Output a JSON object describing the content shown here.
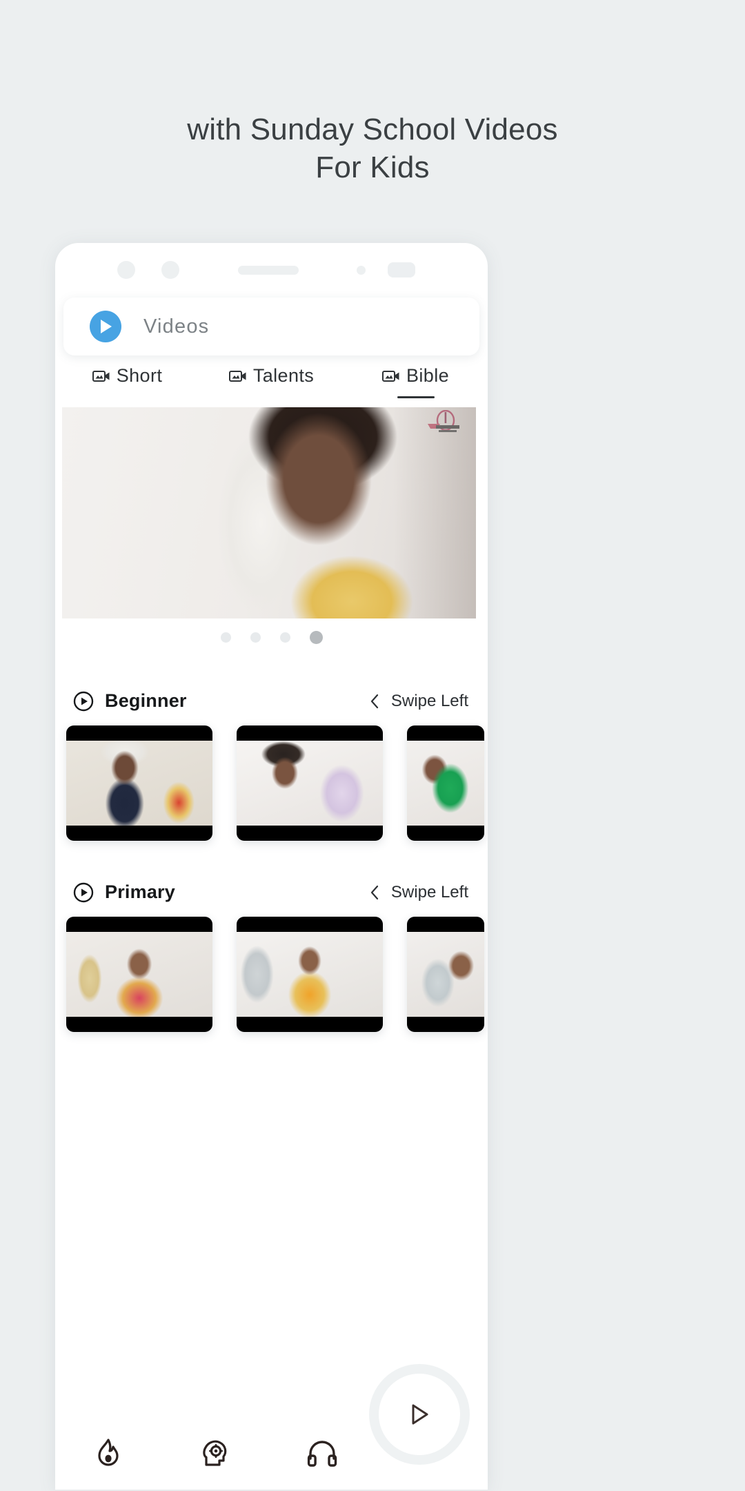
{
  "headline": {
    "line1": "with Sunday School Videos",
    "line2": "For Kids"
  },
  "app": {
    "search_bar": {
      "label": "Videos",
      "icon": "play-circle-icon",
      "accent_color": "#47a3e3"
    },
    "tabs": [
      {
        "label": "Short",
        "icon": "video-camera-icon",
        "active": false
      },
      {
        "label": "Talents",
        "icon": "video-camera-icon",
        "active": false
      },
      {
        "label": "Bible",
        "icon": "video-camera-icon",
        "active": true
      }
    ],
    "carousel": {
      "dot_count": 4,
      "active_index": 3
    },
    "sections": [
      {
        "title": "Beginner",
        "icon": "play-circle-outline-icon",
        "swipe_label": "Swipe Left",
        "swipe_icon": "chevron-left-icon",
        "cards": [
          "card-1",
          "card-2",
          "card-3"
        ]
      },
      {
        "title": "Primary",
        "icon": "play-circle-outline-icon",
        "swipe_label": "Swipe Left",
        "swipe_icon": "chevron-left-icon",
        "cards": [
          "card-4",
          "card-5",
          "card-6"
        ]
      }
    ],
    "bottom_nav": [
      {
        "icon": "flame-icon"
      },
      {
        "icon": "head-gear-icon"
      },
      {
        "icon": "headphones-icon"
      }
    ],
    "fab": {
      "icon": "play-triangle-icon"
    }
  },
  "colors": {
    "page_background": "#eceff0",
    "phone_background": "#ffffff",
    "headline_text": "#3b4043",
    "accent_blue": "#47a3e3",
    "active_tab_underline": "#2f3336"
  }
}
